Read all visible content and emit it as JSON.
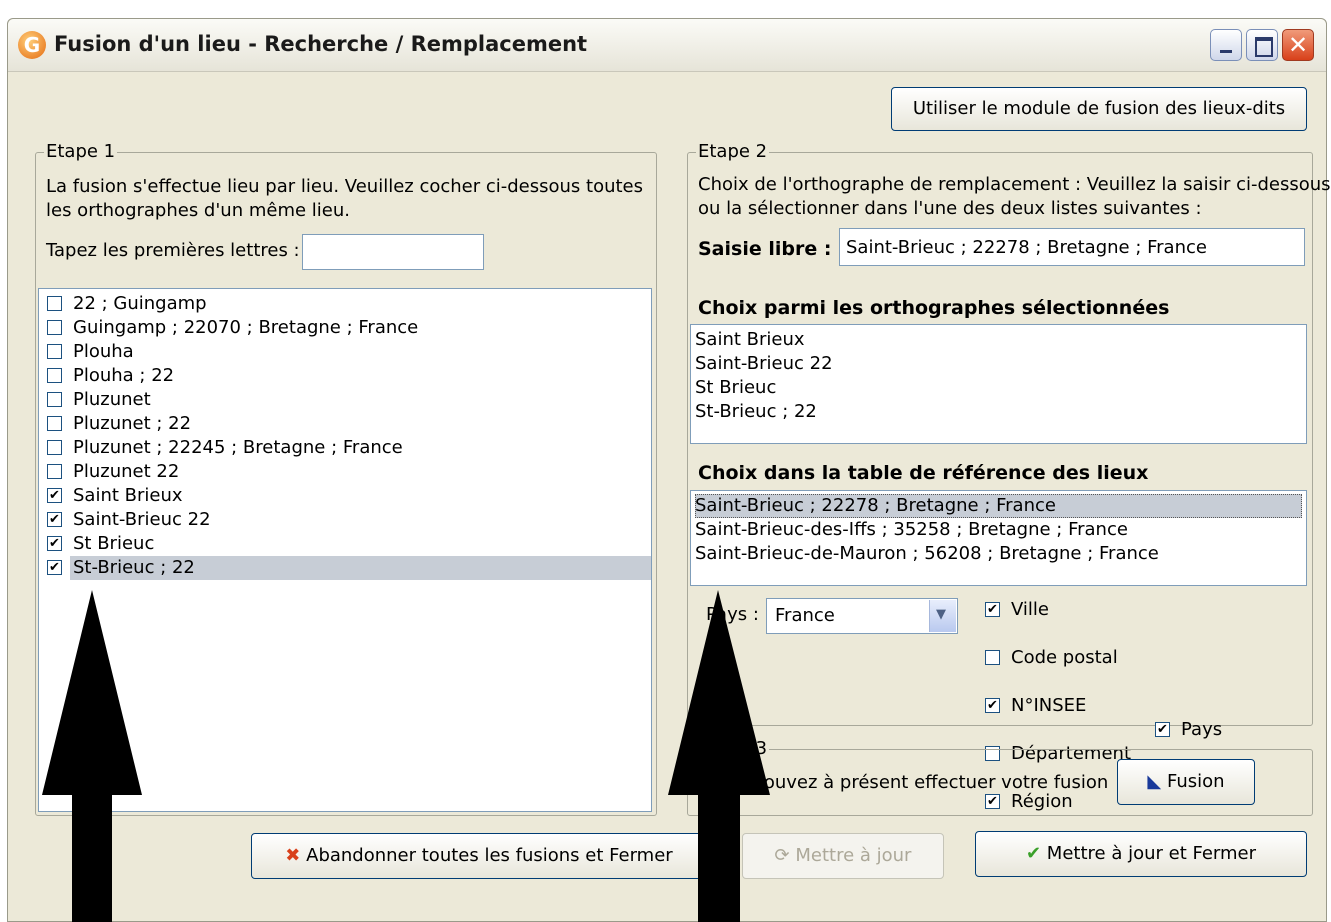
{
  "window": {
    "title": "Fusion d'un lieu - Recherche / Remplacement",
    "app_icon": "G"
  },
  "top_button": "Utiliser le module de fusion des lieux-dits",
  "step1": {
    "legend": "Etape 1",
    "desc_line1": "La fusion s'effectue lieu par lieu. Veuillez cocher ci-dessous toutes",
    "desc_line2": "les orthographes d'un même lieu.",
    "search_label": "Tapez les premières lettres :",
    "search_value": "",
    "items": [
      {
        "label": "22 ; Guingamp",
        "checked": false
      },
      {
        "label": "Guingamp ; 22070 ; Bretagne ; France",
        "checked": false
      },
      {
        "label": "Plouha",
        "checked": false
      },
      {
        "label": "Plouha ; 22",
        "checked": false
      },
      {
        "label": "Pluzunet",
        "checked": false
      },
      {
        "label": "Pluzunet ; 22",
        "checked": false
      },
      {
        "label": "Pluzunet ; 22245 ; Bretagne ; France",
        "checked": false
      },
      {
        "label": "Pluzunet 22",
        "checked": false
      },
      {
        "label": "Saint Brieux",
        "checked": true
      },
      {
        "label": "Saint-Brieuc 22",
        "checked": true
      },
      {
        "label": "St Brieuc",
        "checked": true
      },
      {
        "label": "St-Brieuc ; 22",
        "checked": true,
        "selected": true
      }
    ]
  },
  "step2": {
    "legend": "Etape 2",
    "desc_line1": "Choix de l'orthographe de remplacement : Veuillez la saisir ci-dessous",
    "desc_line2": "ou la sélectionner dans l'une des deux listes suivantes :",
    "free_label": "Saisie libre :",
    "free_value": "Saint-Brieuc ; 22278 ; Bretagne ; France",
    "selected_heading": "Choix parmi les orthographes sélectionnées",
    "selected_items": [
      "Saint Brieux",
      "Saint-Brieuc 22",
      "St Brieuc",
      "St-Brieuc ; 22"
    ],
    "ref_heading": "Choix dans la table de référence des lieux",
    "ref_items": [
      {
        "label": "Saint-Brieuc ; 22278 ; Bretagne ; France",
        "selected": true
      },
      {
        "label": "Saint-Brieuc-des-Iffs ; 35258 ; Bretagne ; France",
        "selected": false
      },
      {
        "label": "Saint-Brieuc-de-Mauron ; 56208 ; Bretagne ; France",
        "selected": false
      }
    ],
    "country_label": "Pays :",
    "country_value": "France",
    "options": [
      {
        "label": "Ville",
        "checked": true
      },
      {
        "label": "Code postal",
        "checked": false
      },
      {
        "label": "N°INSEE",
        "checked": true
      },
      {
        "label": "Département",
        "checked": false
      },
      {
        "label": "Région",
        "checked": true
      }
    ],
    "option_pays": {
      "label": "Pays",
      "checked": true
    }
  },
  "step3": {
    "legend": "Etape 3",
    "desc": "Vous pouvez à présent effectuer votre fusion",
    "fusion_button": "Fusion"
  },
  "bottom": {
    "abandon_button": "Abandonner toutes les fusions et Fermer",
    "update_button": "Mettre à jour",
    "update_close_button": "Mettre à jour et Fermer"
  },
  "colors": {
    "selection": "#c7cdd6",
    "window_bg": "#ece9d8",
    "close_red": "#d8401a",
    "check_green": "#3aa02a"
  }
}
